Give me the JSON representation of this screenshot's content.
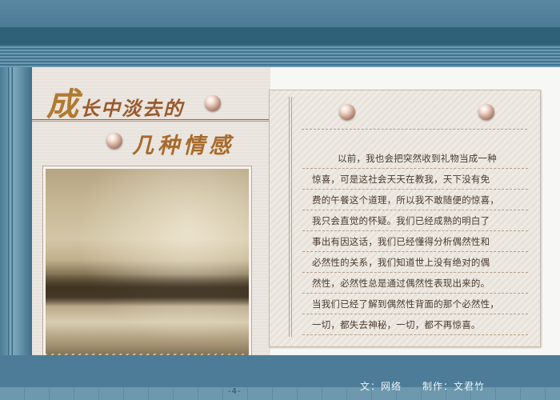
{
  "title": {
    "big_char": "成",
    "line1_rest": "长中淡去的",
    "line2": "几种情感"
  },
  "paragraph_lines": [
    "以前，我也会把突然收到礼物当成一种",
    "惊喜，可是这社会天天在教我，天下没有免",
    "费的午餐这个道理，所以我不敢随便的惊喜，",
    "我只会直觉的怀疑。我们已经成熟的明白了",
    "事出有因这话，我们已经懂得分析偶然性和",
    "必然性的关系，我们知道世上没有绝对的偶",
    "然性，必然性总是通过偶然性表现出来的。",
    "当我们已经了解到偶然性背面的那个必然性，",
    "一切，都失去神秘，一切，都不再惊喜。"
  ],
  "credits": "文：网络　　制作：文君竹",
  "page_number": "-4-",
  "colors": {
    "frame_blue": "#4f7f99",
    "title_brown": "#9a5a2c",
    "paper": "#efebe4"
  }
}
